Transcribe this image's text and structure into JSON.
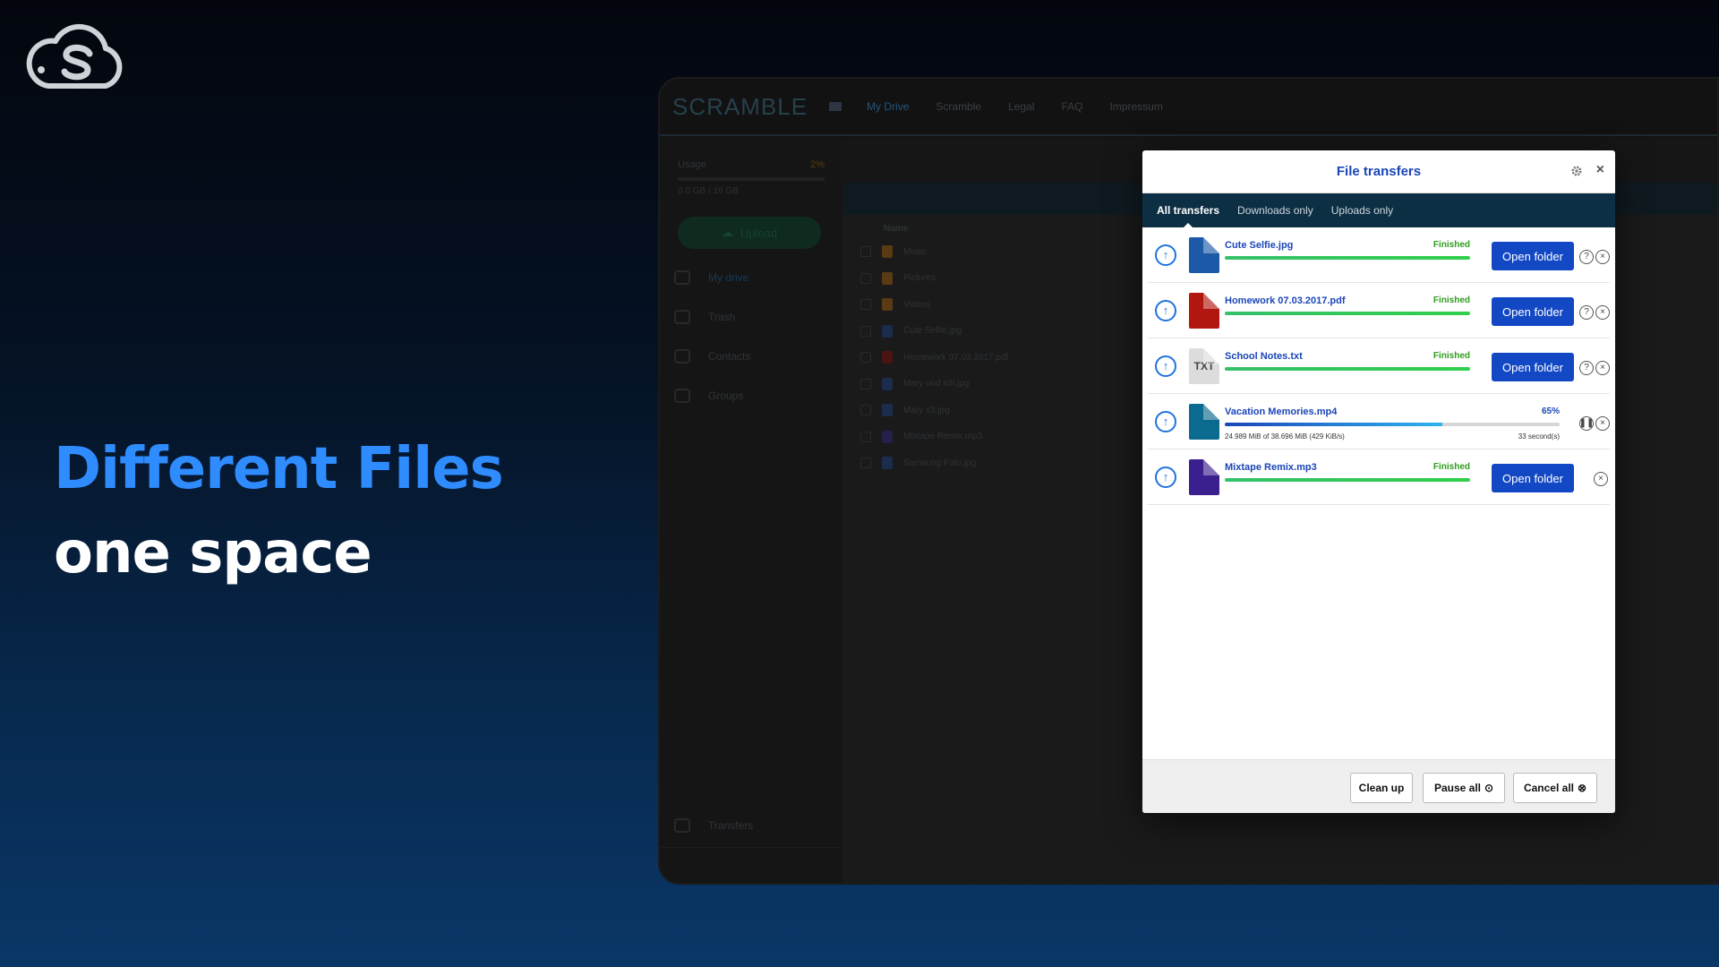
{
  "hero": {
    "title": "Different Files",
    "subtitle": "one space"
  },
  "app": {
    "brand": "SCRAMBLE",
    "nav": [
      "My Drive",
      "Scramble",
      "Legal",
      "FAQ",
      "Impressum"
    ],
    "sidebar": {
      "usage_label": "Usage",
      "usage_percent": "2%",
      "usage_value": "0.0 GB / 16 GB",
      "upload_label": "Upload",
      "items": [
        "My drive",
        "Trash",
        "Contacts",
        "Groups"
      ],
      "transfers_label": "Transfers"
    },
    "files": {
      "header": "Name",
      "items": [
        {
          "name": "Music",
          "color": "#5a3a12"
        },
        {
          "name": "Pictures",
          "color": "#5a3a12"
        },
        {
          "name": "Videos",
          "color": "#5a3a12"
        },
        {
          "name": "Cute Selfie.jpg",
          "color": "#1c2c4c"
        },
        {
          "name": "Homework 07.03.2017.pdf",
          "color": "#4a1414"
        },
        {
          "name": "Mary und ich.jpg",
          "color": "#1c2c4c"
        },
        {
          "name": "Mary x3.jpg",
          "color": "#1c2c4c"
        },
        {
          "name": "Mixtape Remix.mp3",
          "color": "#24204a"
        },
        {
          "name": "Samsung Foto.jpg",
          "color": "#1c2c4c"
        }
      ]
    }
  },
  "dialog": {
    "title": "File transfers",
    "tabs": [
      "All transfers",
      "Downloads only",
      "Uploads only"
    ],
    "open_folder_label": "Open folder",
    "transfers": [
      {
        "name": "Cute Selfie.jpg",
        "status": "Finished",
        "progress": 1.0,
        "type_icon": "image-file-icon",
        "icon_color": "#1c5aa8",
        "icon_label": ""
      },
      {
        "name": "Homework 07.03.2017.pdf",
        "status": "Finished",
        "progress": 1.0,
        "type_icon": "pdf-file-icon",
        "icon_color": "#b2170f",
        "icon_label": ""
      },
      {
        "name": "School Notes.txt",
        "status": "Finished",
        "progress": 1.0,
        "type_icon": "txt-file-icon",
        "icon_color": "#dcdcdc",
        "icon_label": "TXT"
      },
      {
        "name": "Vacation Memories.mp4",
        "status": "65%",
        "progress": 0.65,
        "type_icon": "video-file-icon",
        "icon_color": "#0b6a8f",
        "icon_label": "",
        "detail_left": "24.989 MiB  of  38.696 MiB  (429 KiB/s)",
        "detail_right": "33 second(s)"
      },
      {
        "name": "Mixtape Remix.mp3",
        "status": "Finished",
        "progress": 1.0,
        "type_icon": "audio-file-icon",
        "icon_color": "#3a1f8f",
        "icon_label": ""
      }
    ],
    "footer": {
      "clean_up": "Clean up",
      "pause_all": "Pause all",
      "cancel_all": "Cancel all"
    }
  }
}
